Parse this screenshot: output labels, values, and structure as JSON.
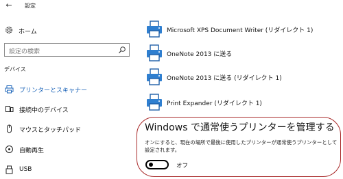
{
  "titlebar": {
    "back_icon": "back-arrow-icon",
    "title": "設定"
  },
  "sidebar": {
    "home_label": "ホーム",
    "search_placeholder": "設定の検索",
    "section_label": "デバイス",
    "items": [
      {
        "label": "プリンターとスキャナー",
        "icon": "printer-icon",
        "active": true
      },
      {
        "label": "接続中のデバイス",
        "icon": "connected-device-icon",
        "active": false
      },
      {
        "label": "マウスとタッチパッド",
        "icon": "mouse-icon",
        "active": false
      },
      {
        "label": "自動再生",
        "icon": "autoplay-icon",
        "active": false
      },
      {
        "label": "USB",
        "icon": "usb-icon",
        "active": false
      }
    ]
  },
  "printers": [
    {
      "name": "Microsoft XPS Document Writer (リダイレクト 1)"
    },
    {
      "name": "OneNote 2013 に送る"
    },
    {
      "name": "OneNote 2013 に送る (リダイレクト 1)"
    },
    {
      "name": "Print Expander (リダイレクト 1)"
    }
  ],
  "manage_default": {
    "title": "Windows で通常使うプリンターを管理する",
    "description": "オンにすると、現在の場所で最後に使用したプリンターが通常使うプリンターとして設定されます。",
    "toggle_state": "オフ",
    "toggle_on": false
  },
  "colors": {
    "accent": "#1a63b8",
    "highlight_border": "#a82828"
  }
}
